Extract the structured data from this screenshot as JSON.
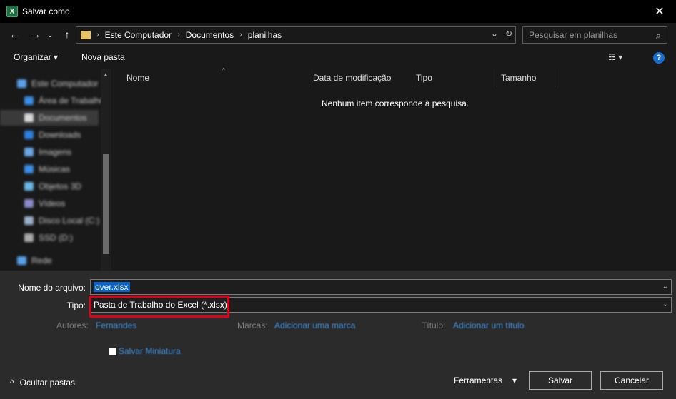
{
  "window": {
    "title": "Salvar como",
    "app_icon_letter": "X",
    "close_glyph": "✕"
  },
  "nav": {
    "back_glyph": "←",
    "forward_glyph": "→",
    "history_glyph": "⌄",
    "up_glyph": "↑",
    "breadcrumb": [
      "Este Computador",
      "Documentos",
      "planilhas"
    ],
    "breadcrumb_sep": "›",
    "refresh_glyph": "↻",
    "dropdown_glyph": "⌄",
    "search_placeholder": "Pesquisar em planilhas",
    "search_glyph": "⌕"
  },
  "toolbar": {
    "organize_label": "Organizar ▾",
    "new_folder_label": "Nova pasta",
    "view_glyph": "☷ ▾",
    "help_glyph": "?"
  },
  "sidebar": {
    "items": [
      {
        "label": "Este Computador",
        "icon": "computer-icon",
        "color": "#5aa0e8"
      },
      {
        "label": "Área de Trabalho",
        "icon": "desktop-icon",
        "color": "#3a8ee6"
      },
      {
        "label": "Documentos",
        "icon": "documents-icon",
        "color": "#d8d8d8"
      },
      {
        "label": "Downloads",
        "icon": "downloads-icon",
        "color": "#2f7fe0"
      },
      {
        "label": "Imagens",
        "icon": "images-icon",
        "color": "#6aa8e8"
      },
      {
        "label": "Músicas",
        "icon": "music-icon",
        "color": "#3a8ee6"
      },
      {
        "label": "Objetos 3D",
        "icon": "objects-3d-icon",
        "color": "#6ab8e8"
      },
      {
        "label": "Vídeos",
        "icon": "videos-icon",
        "color": "#8a8ac8"
      },
      {
        "label": "Disco Local (C:)",
        "icon": "drive-icon",
        "color": "#9ab0c8"
      },
      {
        "label": "SSD (D:)",
        "icon": "drive-icon",
        "color": "#aaaaaa"
      },
      {
        "label": "Rede",
        "icon": "network-icon",
        "color": "#5aa0e8"
      }
    ]
  },
  "columns": [
    "Nome",
    "Data de modificação",
    "Tipo",
    "Tamanho"
  ],
  "empty_message": "Nenhum item corresponde à pesquisa.",
  "form": {
    "filename_label": "Nome do arquivo:",
    "filename_value": "over.xlsx",
    "type_label": "Tipo:",
    "type_value": "Pasta de Trabalho do Excel (*.xlsx)",
    "authors_label": "Autores:",
    "authors_value": "Fernandes",
    "tags_label": "Marcas:",
    "tags_value": "Adicionar uma marca",
    "title_label": "Título:",
    "title_value": "Adicionar um título",
    "thumbnail_label": "Salvar Miniatura",
    "dropdown_glyph": "⌄"
  },
  "footer": {
    "hide_folders_glyph": "^",
    "hide_folders_label": "Ocultar pastas",
    "tools_label": "Ferramentas",
    "tools_glyph": "▾",
    "save_label": "Salvar",
    "cancel_label": "Cancelar"
  },
  "colors": {
    "highlight_box": "#e0001a",
    "link": "#3f8fdc",
    "selection": "#0a64c8"
  }
}
